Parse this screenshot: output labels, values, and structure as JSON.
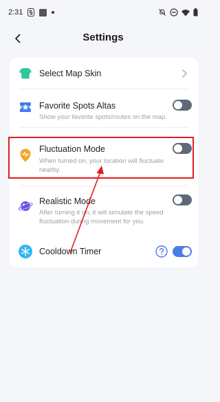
{
  "status_bar": {
    "time": "2:31"
  },
  "header": {
    "title": "Settings"
  },
  "settings": [
    {
      "title": "Select Map Skin"
    },
    {
      "title": "Favorite Spots Altas",
      "description": "Show your favorite spots/routes on the map.",
      "enabled": false
    },
    {
      "title": "Fluctuation Mode",
      "description": "When turned on, your location will fluctuate nearby.",
      "enabled": false
    },
    {
      "title": "Realistic Mode",
      "description": "After turning it on, it will simulate the speed fluctuation during movement for you.",
      "enabled": false
    },
    {
      "title": "Cooldown Timer",
      "enabled": true
    }
  ],
  "colors": {
    "accent": "#4a7ee6",
    "toggle_off": "#5f6a78",
    "annotation": "#e31c1c",
    "fluctuation_icon": "#f5a623"
  },
  "icons": [
    "shirt-icon",
    "star-ticket-icon",
    "location-pulse-icon",
    "planet-icon",
    "snowflake-icon",
    "help-icon"
  ]
}
